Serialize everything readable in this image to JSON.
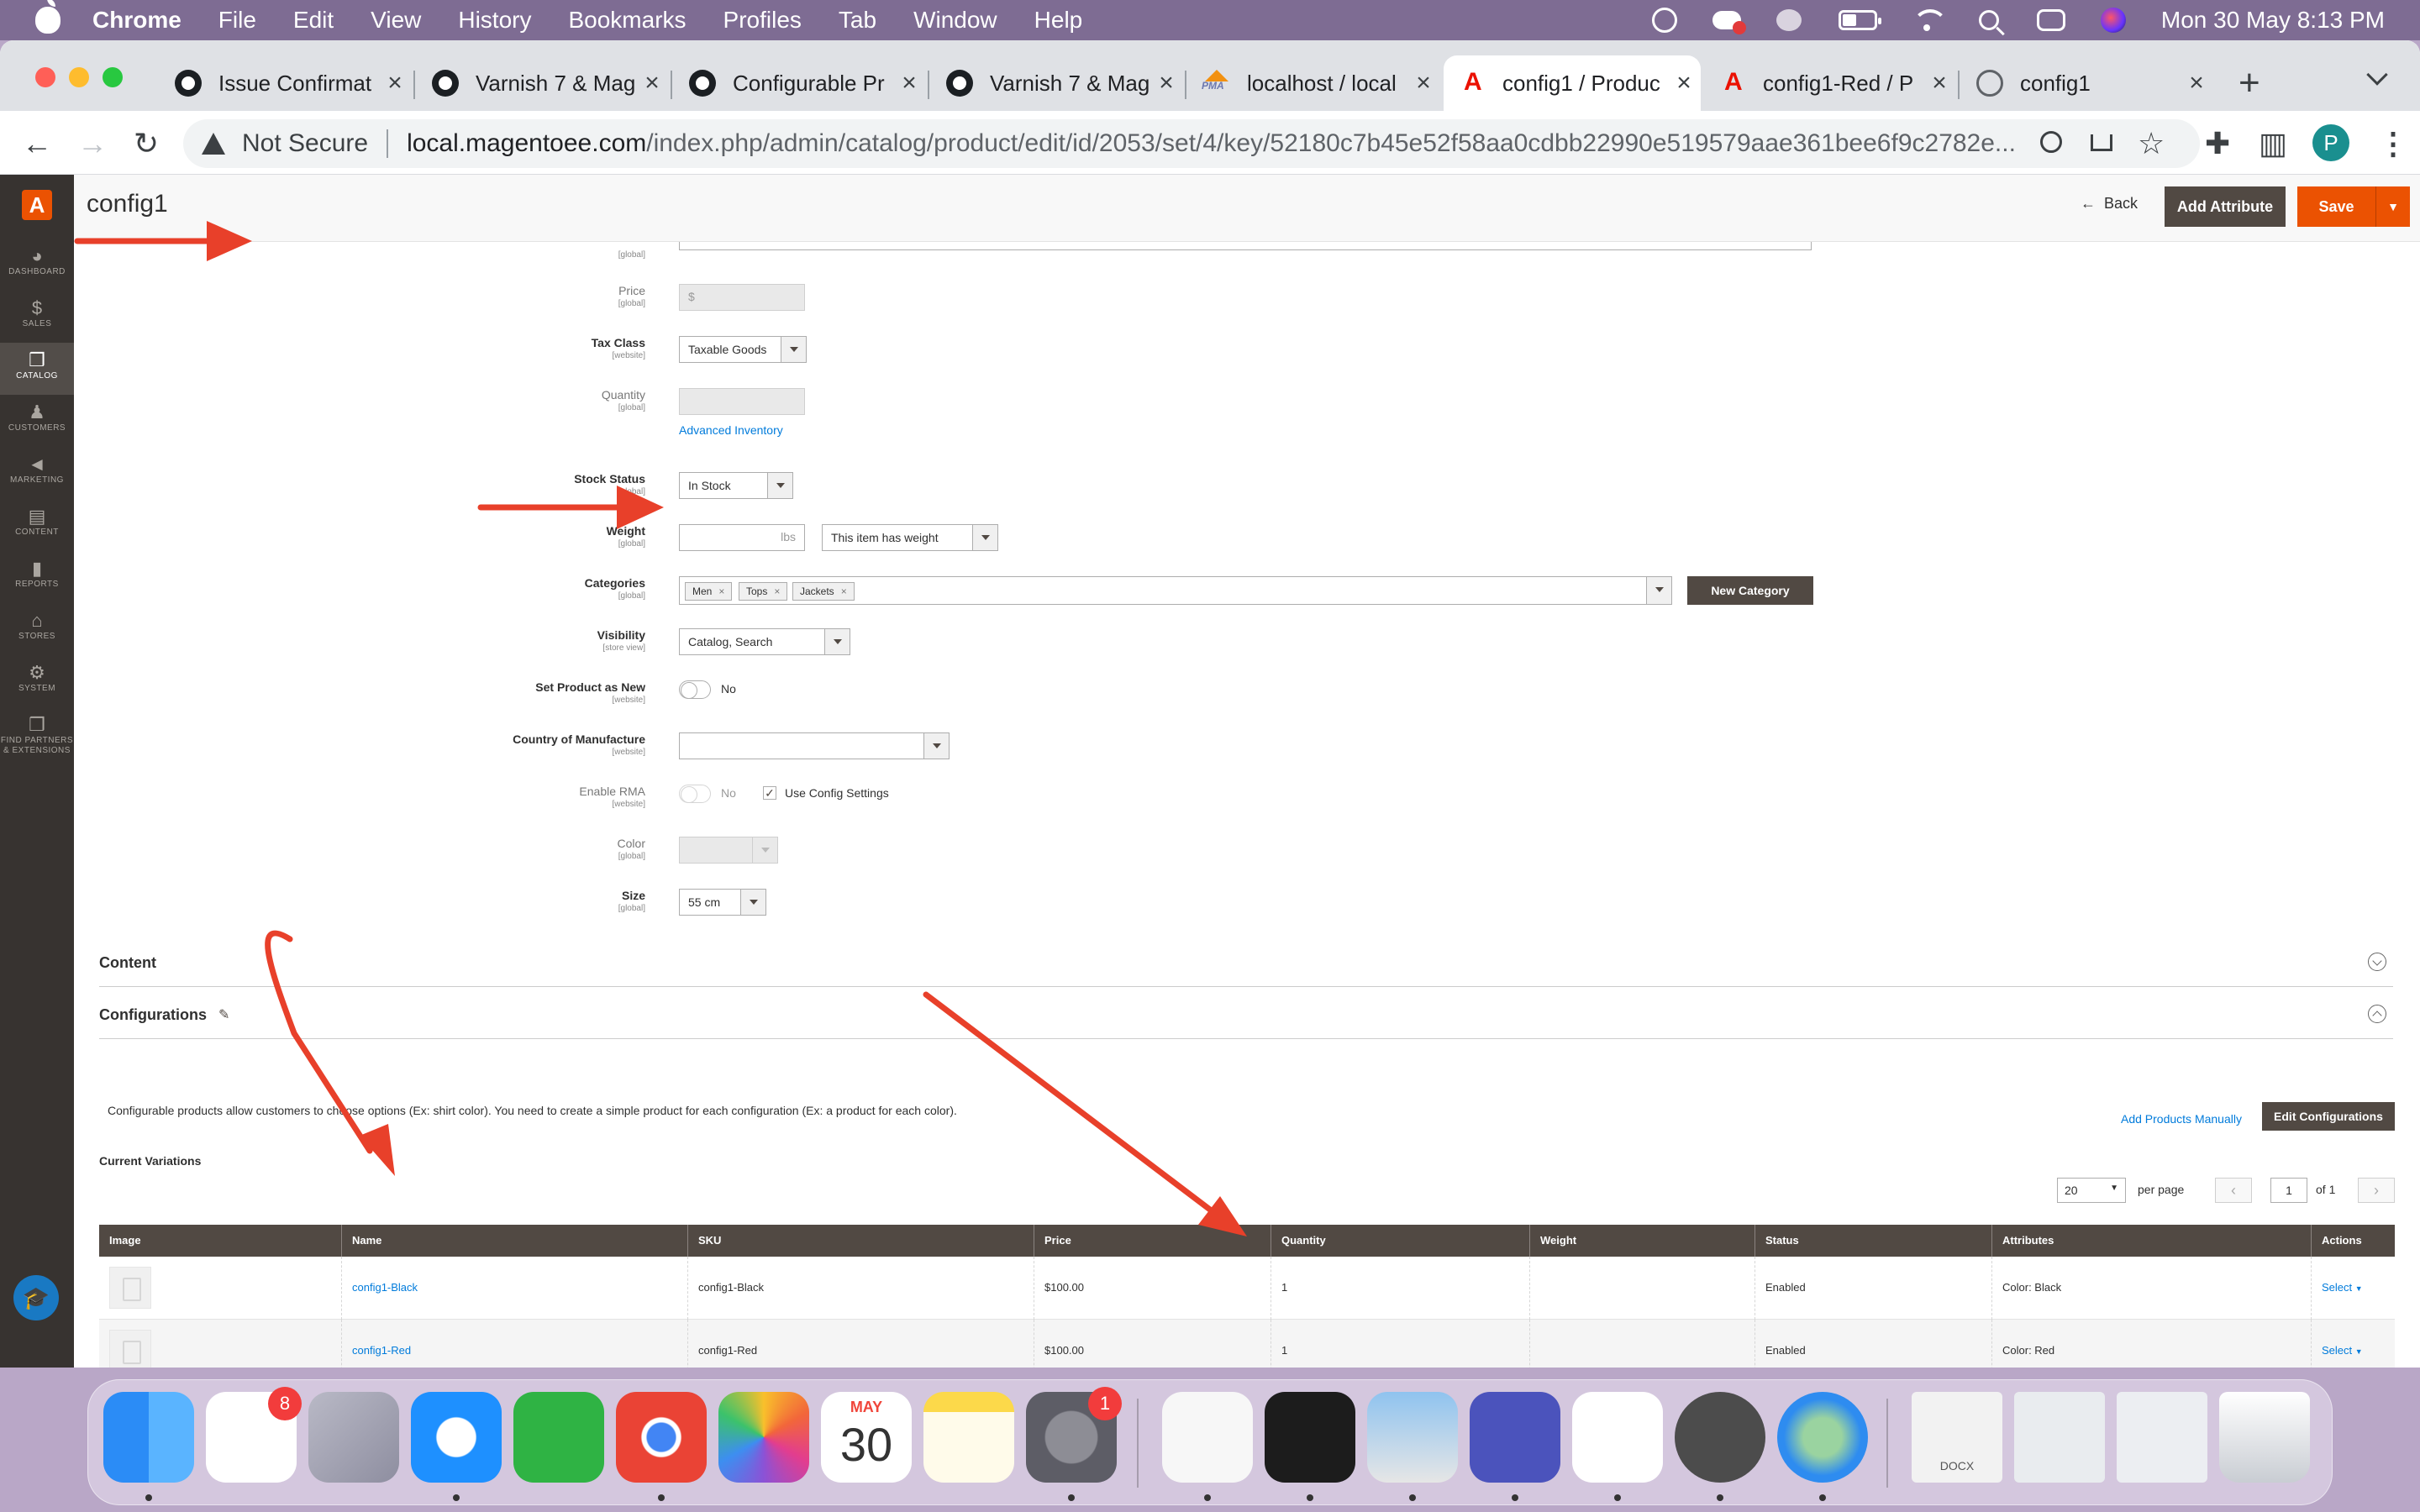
{
  "menubar": {
    "app": "Chrome",
    "items": [
      "File",
      "Edit",
      "View",
      "History",
      "Bookmarks",
      "Profiles",
      "Tab",
      "Window",
      "Help"
    ],
    "clock": "Mon 30 May  8:13 PM"
  },
  "browser": {
    "tabs": [
      {
        "title": "Issue Confirmat",
        "icon": "github-icon"
      },
      {
        "title": "Varnish 7 & Mag",
        "icon": "github-icon"
      },
      {
        "title": "Configurable Pr",
        "icon": "github-icon"
      },
      {
        "title": "Varnish 7 & Mag",
        "icon": "github-icon"
      },
      {
        "title": "localhost / local",
        "icon": "phpmyadmin-icon"
      },
      {
        "title": "config1 / Produc",
        "icon": "adobe-icon"
      },
      {
        "title": "config1-Red / P",
        "icon": "adobe-icon"
      },
      {
        "title": "config1",
        "icon": "globe-icon"
      }
    ],
    "address": {
      "security": "Not Secure",
      "host": "local.magentoee.com",
      "path": "/index.php/admin/catalog/product/edit/id/2053/set/4/key/52180c7b45e52f58aa0cdbb22990e519579aae361bee6f9c2782e..."
    },
    "profile_initial": "P"
  },
  "admin": {
    "nav": [
      {
        "label": "DASHBOARD",
        "glyph": "◕"
      },
      {
        "label": "SALES",
        "glyph": "$"
      },
      {
        "label": "CATALOG",
        "glyph": "❒"
      },
      {
        "label": "CUSTOMERS",
        "glyph": "♟"
      },
      {
        "label": "MARKETING",
        "glyph": "📢"
      },
      {
        "label": "CONTENT",
        "glyph": "▤"
      },
      {
        "label": "REPORTS",
        "glyph": "▮"
      },
      {
        "label": "STORES",
        "glyph": "⌂"
      },
      {
        "label": "SYSTEM",
        "glyph": "⚙"
      },
      {
        "label": "FIND PARTNERS",
        "label2": "& EXTENSIONS",
        "glyph": "❒"
      }
    ],
    "header": {
      "title": "config1",
      "back": "Back",
      "add_attribute": "Add Attribute",
      "save": "Save"
    },
    "form": {
      "sku_scope": "[global]",
      "price": {
        "label": "Price",
        "scope": "[global]",
        "prefix": "$"
      },
      "tax_class": {
        "label": "Tax Class",
        "scope": "[website]",
        "value": "Taxable Goods"
      },
      "quantity": {
        "label": "Quantity",
        "scope": "[global]",
        "link": "Advanced Inventory"
      },
      "stock_status": {
        "label": "Stock Status",
        "scope": "[global]",
        "value": "In Stock"
      },
      "weight": {
        "label": "Weight",
        "scope": "[global]",
        "unit": "lbs",
        "type": "This item has weight"
      },
      "categories": {
        "label": "Categories",
        "scope": "[global]",
        "chips": [
          "Men",
          "Tops",
          "Jackets"
        ],
        "new_button": "New Category"
      },
      "visibility": {
        "label": "Visibility",
        "scope": "[store view]",
        "value": "Catalog, Search"
      },
      "set_new": {
        "label": "Set Product as New",
        "scope": "[website]",
        "value": "No"
      },
      "country": {
        "label": "Country of Manufacture",
        "scope": "[website]",
        "value": ""
      },
      "rma": {
        "label": "Enable RMA",
        "scope": "[website]",
        "value": "No",
        "use_config": "Use Config Settings"
      },
      "color": {
        "label": "Color",
        "scope": "[global]",
        "value": ""
      },
      "size": {
        "label": "Size",
        "scope": "[global]",
        "value": "55 cm"
      }
    },
    "content_section": {
      "title": "Content"
    },
    "configurations": {
      "title": "Configurations",
      "description": "Configurable products allow customers to choose options (Ex: shirt color). You need to create a simple product for each configuration (Ex: a product for each color).",
      "add_manually": "Add Products Manually",
      "edit_button": "Edit Configurations",
      "current_variations": "Current Variations",
      "pager": {
        "per_page_value": "20",
        "per_page_label": "per page",
        "page": "1",
        "of": "of 1"
      },
      "columns": [
        "Image",
        "Name",
        "SKU",
        "Price",
        "Quantity",
        "Weight",
        "Status",
        "Attributes",
        "Actions"
      ],
      "rows": [
        {
          "name": "config1-Black",
          "sku": "config1-Black",
          "price": "$100.00",
          "quantity": "1",
          "weight": "",
          "status": "Enabled",
          "attributes": "Color: Black",
          "action": "Select"
        },
        {
          "name": "config1-Red",
          "sku": "config1-Red",
          "price": "$100.00",
          "quantity": "1",
          "weight": "",
          "status": "Enabled",
          "attributes": "Color: Red",
          "action": "Select"
        }
      ]
    }
  },
  "dock": {
    "reminders_badge": "8",
    "calendar_month": "MAY",
    "calendar_day": "30",
    "settings_badge": "1",
    "docx_label": "DOCX"
  },
  "colors": {
    "accent_orange": "#eb5202",
    "admin_dark": "#514943",
    "nav_bg": "#373330",
    "link_blue": "#007bdb",
    "annotation_red": "#e8402a"
  }
}
